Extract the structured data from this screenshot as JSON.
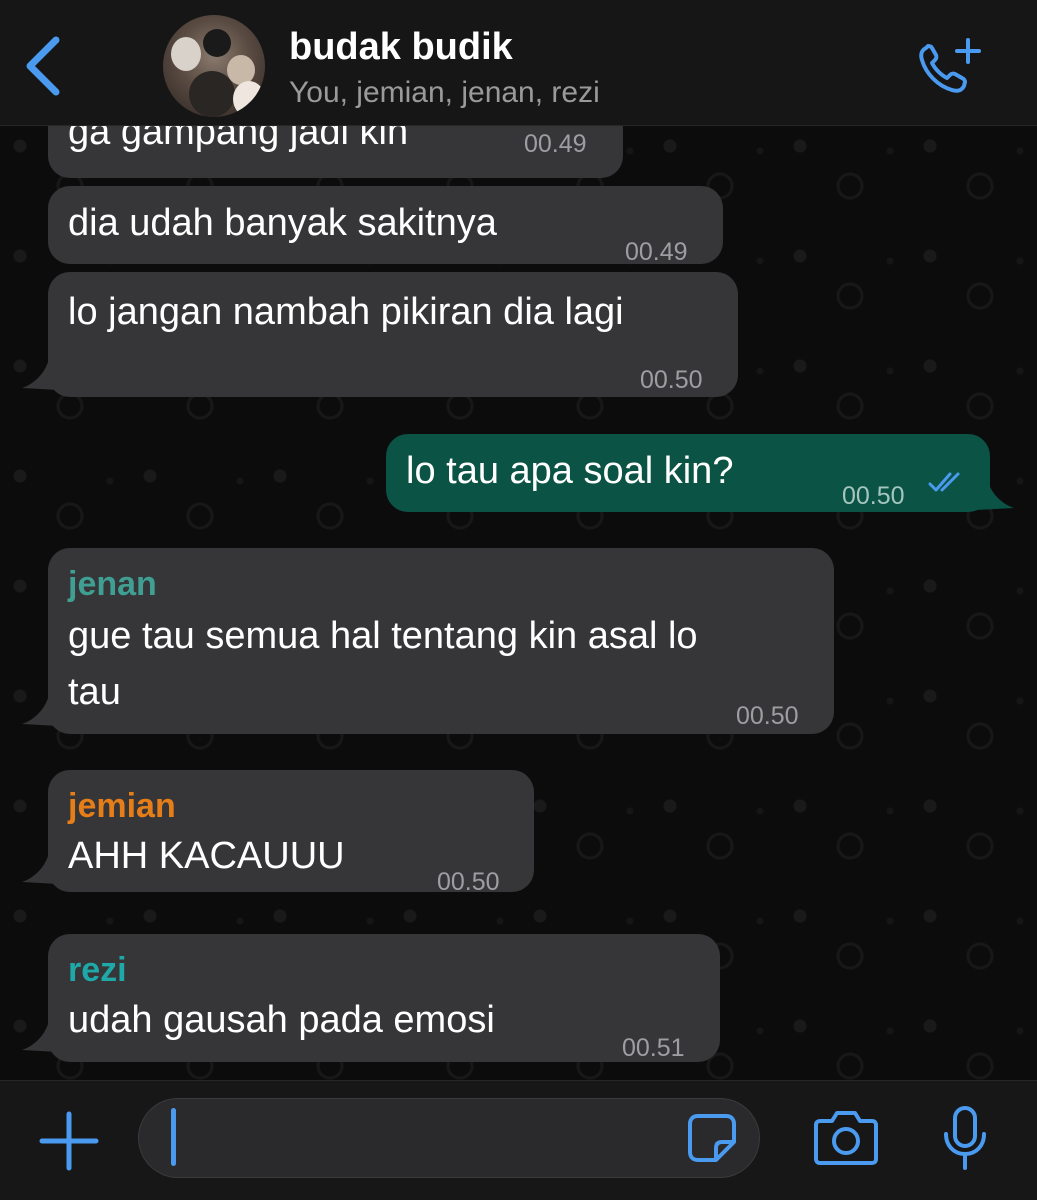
{
  "header": {
    "title": "budak budik",
    "subtitle": "You, jemian, jenan, rezi",
    "icons": {
      "back": "chevron-left-icon",
      "call": "phone-plus-icon"
    }
  },
  "messages": [
    {
      "text": "ga gampang jadi kin",
      "time": "00.49"
    },
    {
      "text": "dia udah banyak sakitnya",
      "time": "00.49"
    },
    {
      "text": "lo jangan nambah pikiran dia lagi",
      "time": "00.50"
    },
    {
      "text": "lo tau apa soal kin?",
      "time": "00.50",
      "outgoing": true,
      "read": true
    },
    {
      "sender": "jenan",
      "sender_color": "#3f9f93",
      "line1": "gue tau semua hal tentang kin asal lo",
      "line2": "tau",
      "time": "00.50"
    },
    {
      "sender": "jemian",
      "sender_color": "#e57d19",
      "text": "AHH KACAUUU",
      "time": "00.50"
    },
    {
      "sender": "rezi",
      "sender_color": "#1fa8a8",
      "text": "udah gausah pada emosi",
      "time": "00.51"
    }
  ],
  "input": {
    "value": "",
    "icons": {
      "attach": "plus-icon",
      "sticker": "sticker-icon",
      "camera": "camera-icon",
      "mic": "microphone-icon"
    }
  },
  "colors": {
    "accent": "#4a9bf0",
    "incoming_bubble": "#363638",
    "outgoing_bubble": "#0b5345",
    "read_receipt": "#4a9bf0"
  }
}
